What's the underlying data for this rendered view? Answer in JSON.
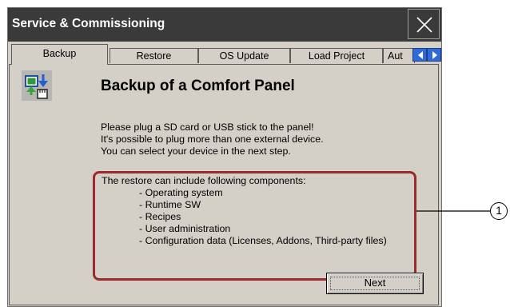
{
  "window": {
    "title": "Service & Commissioning"
  },
  "tabs": [
    {
      "label": "Backup",
      "active": true
    },
    {
      "label": "Restore",
      "active": false
    },
    {
      "label": "OS Update",
      "active": false
    },
    {
      "label": "Load Project",
      "active": false
    },
    {
      "label": "Aut",
      "active": false
    }
  ],
  "content": {
    "heading": "Backup of a Comfort Panel",
    "intro": [
      "Please plug a SD card or USB stick to the panel!",
      "It's possible to plug more than one external device.",
      "You can select your device in the next step."
    ],
    "components_title": "The restore can include following components:",
    "components": [
      "- Operating system",
      "- Runtime SW",
      "- Recipes",
      "- User administration",
      "- Configuration data (Licenses, Addons, Third-party files)"
    ],
    "next_label": "Next"
  },
  "callout": {
    "number": "1"
  },
  "icons": {
    "close": "close-icon",
    "tab_left": "arrow-left-icon",
    "tab_right": "arrow-right-icon",
    "backup": "backup-icon"
  },
  "colors": {
    "titlebar": "#3a3a3a",
    "dialog_bg": "#d4d0c8",
    "highlight_border": "#9b2a2a",
    "scroll_button": "#2f6bd8"
  }
}
